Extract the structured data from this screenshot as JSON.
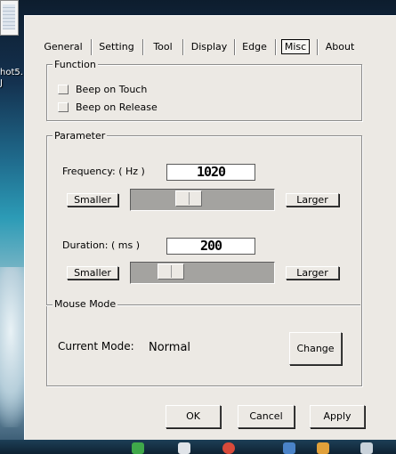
{
  "desktop": {
    "icon_label_line1": "hot5.",
    "icon_label_line2": "J"
  },
  "tabs": [
    "General",
    "Setting",
    "Tool",
    "Display",
    "Edge",
    "Misc",
    "About"
  ],
  "active_tab": "Misc",
  "function_group": {
    "title": "Function",
    "beep_on_touch": "Beep on Touch",
    "beep_on_release": "Beep on Release"
  },
  "parameter_group": {
    "title": "Parameter",
    "frequency_label": "Frequency: ( Hz )",
    "frequency_value": "1020",
    "frequency_level": 0.38,
    "duration_label": "Duration: ( ms )",
    "duration_value": "200",
    "duration_level": 0.23,
    "smaller_label": "Smaller",
    "larger_label": "Larger"
  },
  "mouse_mode_group": {
    "title": "Mouse Mode",
    "current_mode_label": "Current Mode:",
    "current_mode_value": "Normal",
    "change_label": "Change"
  },
  "buttons": {
    "ok": "OK",
    "cancel": "Cancel",
    "apply": "Apply"
  },
  "colors": {
    "dialog_bg": "#ece9e4",
    "slider_track": "#a4a3a0"
  }
}
